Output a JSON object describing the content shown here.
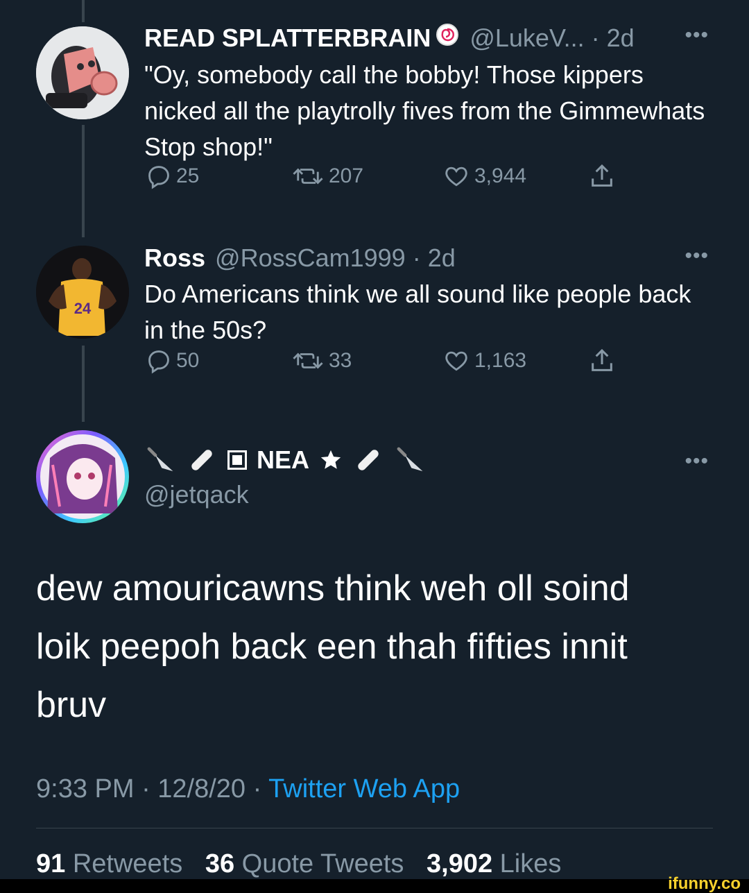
{
  "tweets": [
    {
      "name": "READ SPLATTERBRAIN",
      "handle": "@LukeV...",
      "time": "· 2d",
      "text": "\"Oy, somebody call the bobby! Those kippers nicked all the playtrolly fives from the Gimmewhats Stop shop!\"",
      "replies": "25",
      "retweets": "207",
      "likes": "3,944"
    },
    {
      "name": "Ross",
      "handle": "@RossCam1999",
      "time": "· 2d",
      "text": "Do Americans think we all sound like people back in the 50s?",
      "replies": "50",
      "retweets": "33",
      "likes": "1,163",
      "avatar_jersey": "24"
    }
  ],
  "focus": {
    "name": "NEA",
    "handle": "@jetqack",
    "text_lines": [
      "dew amouricawns think weh oll soind",
      "loik peepoh back een thah fifties innit",
      "bruv"
    ],
    "time": "9:33 PM · 12/8/20 · ",
    "source": "Twitter Web App",
    "retweets_count": "91",
    "retweets_label": "Retweets",
    "quotes_count": "36",
    "quotes_label": "Quote Tweets",
    "likes_count": "3,902",
    "likes_label": "Likes"
  },
  "more_label": "•••",
  "watermark": "ifunny.co",
  "colors": {
    "background": "#15202b",
    "secondary_text": "#8899a6",
    "link": "#1da1f2",
    "divider": "#38444d"
  }
}
